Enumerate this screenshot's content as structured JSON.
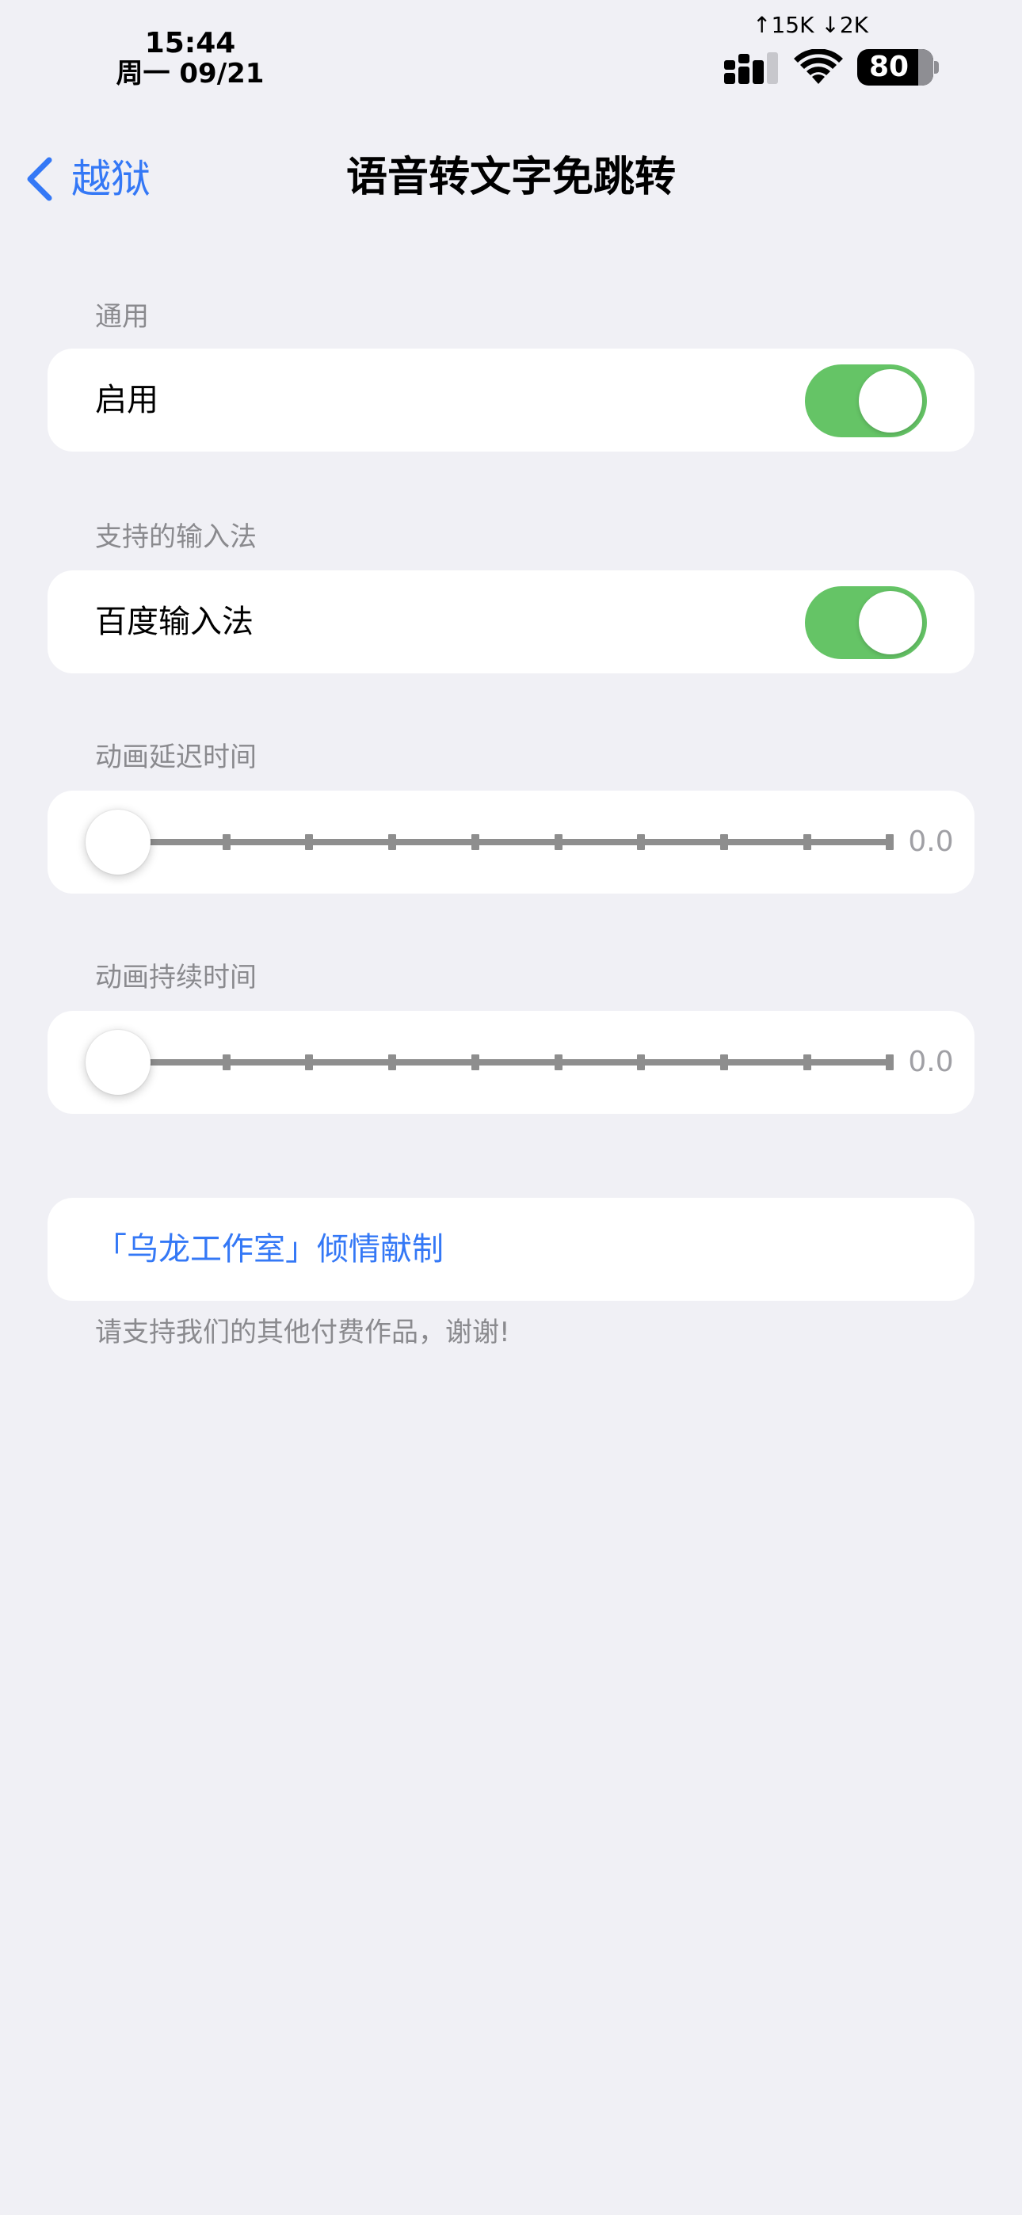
{
  "status_bar": {
    "time": "15:44",
    "date": "周一 09/21",
    "net_speed": "↑15K ↓2K",
    "battery_level": "80",
    "battery_fraction": 0.8
  },
  "nav": {
    "back_label": "越狱",
    "title": "语音转文字免跳转"
  },
  "sections": {
    "general": {
      "header": "通用",
      "enable_label": "启用",
      "enable_on": true
    },
    "input_methods": {
      "header": "支持的输入法",
      "baidu_label": "百度输入法",
      "baidu_on": true
    },
    "anim_delay": {
      "header": "动画延迟时间",
      "value_text": "0.0",
      "value": 0.0
    },
    "anim_duration": {
      "header": "动画持续时间",
      "value_text": "0.0",
      "value": 0.0
    },
    "credits": {
      "link_label": "「乌龙工作室」倾情献制",
      "footer": "请支持我们的其他付费作品，谢谢!"
    }
  },
  "colors": {
    "accent": "#3478f6",
    "toggle_on": "#65c466",
    "background": "#f0f0f5"
  }
}
